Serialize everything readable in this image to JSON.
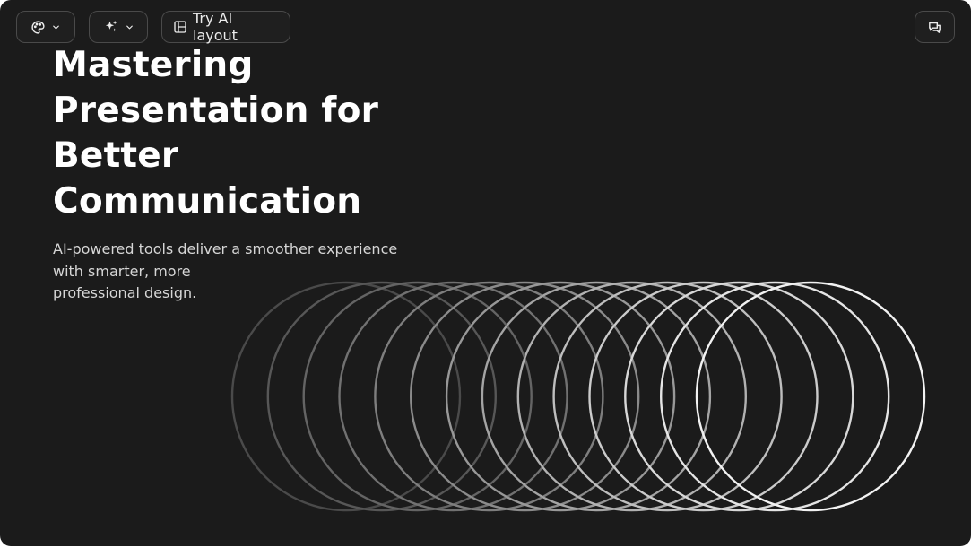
{
  "toolbar": {
    "theme_icon": "palette-icon",
    "magic_icon": "sparkles-icon",
    "dropdown_icon": "chevron-down-icon",
    "ai_layout_icon": "layout-icon",
    "ai_layout_label": "Try AI layout",
    "comment_icon": "comment-icon"
  },
  "slide": {
    "title_lines": [
      "Mastering",
      "Presentation for",
      "Better",
      "Communication"
    ],
    "subtitle_lines": [
      "AI-powered tools deliver a smoother experience",
      "with smarter, more",
      "professional design."
    ]
  },
  "graphic": {
    "ring_count": 14,
    "ring_color_start": "#4a4a4a",
    "ring_color_end": "#f2f2f2"
  },
  "colors": {
    "background": "#1b1b1b",
    "text_primary": "#ffffff",
    "text_secondary": "#d6d6d6",
    "button_border": "#4a4a4a"
  }
}
